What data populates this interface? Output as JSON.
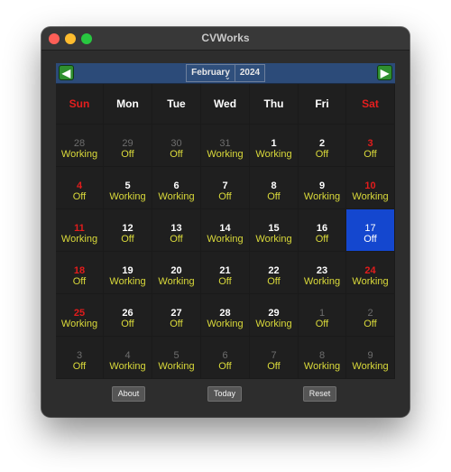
{
  "window": {
    "title": "CVWorks"
  },
  "nav": {
    "prev_icon": "arrow-left-icon",
    "next_icon": "arrow-right-icon",
    "month": "February",
    "year": "2024",
    "chevron": "⌄"
  },
  "weekdays": [
    {
      "label": "Sun",
      "weekend": true
    },
    {
      "label": "Mon",
      "weekend": false
    },
    {
      "label": "Tue",
      "weekend": false
    },
    {
      "label": "Wed",
      "weekend": false
    },
    {
      "label": "Thu",
      "weekend": false
    },
    {
      "label": "Fri",
      "weekend": false
    },
    {
      "label": "Sat",
      "weekend": true
    }
  ],
  "weeks": [
    [
      {
        "day": "28",
        "status": "Working",
        "outside": true
      },
      {
        "day": "29",
        "status": "Off",
        "outside": true
      },
      {
        "day": "30",
        "status": "Off",
        "outside": true
      },
      {
        "day": "31",
        "status": "Working",
        "outside": true
      },
      {
        "day": "1",
        "status": "Working"
      },
      {
        "day": "2",
        "status": "Off"
      },
      {
        "day": "3",
        "status": "Off",
        "weekend": true
      }
    ],
    [
      {
        "day": "4",
        "status": "Off",
        "weekend": true
      },
      {
        "day": "5",
        "status": "Working"
      },
      {
        "day": "6",
        "status": "Working"
      },
      {
        "day": "7",
        "status": "Off"
      },
      {
        "day": "8",
        "status": "Off"
      },
      {
        "day": "9",
        "status": "Working"
      },
      {
        "day": "10",
        "status": "Working",
        "weekend": true
      }
    ],
    [
      {
        "day": "11",
        "status": "Working",
        "weekend": true
      },
      {
        "day": "12",
        "status": "Off"
      },
      {
        "day": "13",
        "status": "Off"
      },
      {
        "day": "14",
        "status": "Working"
      },
      {
        "day": "15",
        "status": "Working"
      },
      {
        "day": "16",
        "status": "Off"
      },
      {
        "day": "17",
        "status": "Off",
        "selected": true
      }
    ],
    [
      {
        "day": "18",
        "status": "Off",
        "weekend": true
      },
      {
        "day": "19",
        "status": "Working"
      },
      {
        "day": "20",
        "status": "Working"
      },
      {
        "day": "21",
        "status": "Off"
      },
      {
        "day": "22",
        "status": "Off"
      },
      {
        "day": "23",
        "status": "Working"
      },
      {
        "day": "24",
        "status": "Working",
        "weekend": true
      }
    ],
    [
      {
        "day": "25",
        "status": "Working",
        "weekend": true
      },
      {
        "day": "26",
        "status": "Off"
      },
      {
        "day": "27",
        "status": "Off"
      },
      {
        "day": "28",
        "status": "Working"
      },
      {
        "day": "29",
        "status": "Working"
      },
      {
        "day": "1",
        "status": "Off",
        "outside": true
      },
      {
        "day": "2",
        "status": "Off",
        "outside": true
      }
    ],
    [
      {
        "day": "3",
        "status": "Off",
        "outside": true
      },
      {
        "day": "4",
        "status": "Working",
        "outside": true
      },
      {
        "day": "5",
        "status": "Working",
        "outside": true
      },
      {
        "day": "6",
        "status": "Off",
        "outside": true
      },
      {
        "day": "7",
        "status": "Off",
        "outside": true
      },
      {
        "day": "8",
        "status": "Working",
        "outside": true
      },
      {
        "day": "9",
        "status": "Working",
        "outside": true
      }
    ]
  ],
  "footer": {
    "about_label": "About",
    "today_label": "Today",
    "reset_label": "Reset"
  },
  "colors": {
    "weekend": "#e21c1c",
    "status": "#dada3a",
    "selected": "#1447cf",
    "nav_bar": "#2c4b79",
    "nav_button": "#2f8f2f"
  }
}
